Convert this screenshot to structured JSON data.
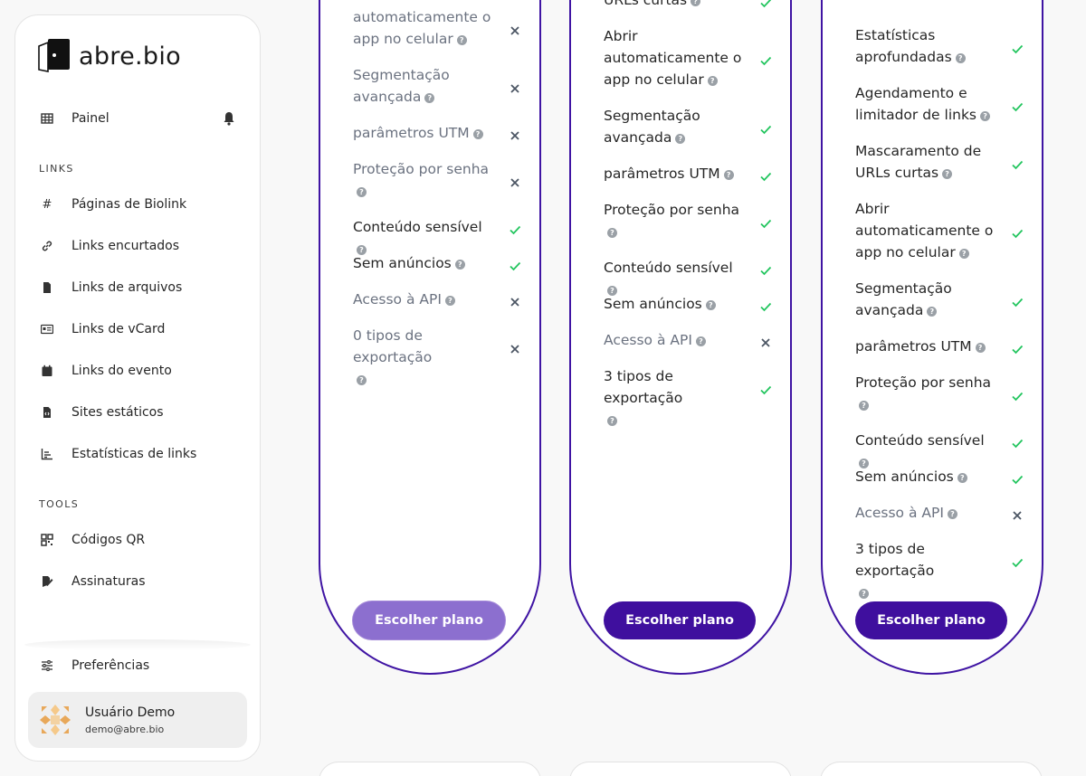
{
  "brand": {
    "name": "abre.bio"
  },
  "sidebar": {
    "dashboard": {
      "label": "Painel"
    },
    "links_section": "LINKS",
    "links_items": [
      {
        "label": "Páginas de Biolink",
        "icon": "hash-icon"
      },
      {
        "label": "Links encurtados",
        "icon": "link-icon"
      },
      {
        "label": "Links de arquivos",
        "icon": "file-icon"
      },
      {
        "label": "Links de vCard",
        "icon": "id-card-icon"
      },
      {
        "label": "Links do evento",
        "icon": "calendar-icon"
      },
      {
        "label": "Sites estáticos",
        "icon": "file-code-icon"
      },
      {
        "label": "Estatísticas de links",
        "icon": "chart-icon"
      }
    ],
    "tools_section": "TOOLS",
    "tools_items": [
      {
        "label": "Códigos QR",
        "icon": "qr-icon"
      },
      {
        "label": "Assinaturas",
        "icon": "signature-icon"
      }
    ],
    "preferences": {
      "label": "Preferências"
    },
    "user": {
      "name": "Usuário Demo",
      "email": "demo@abre.bio"
    }
  },
  "plans": [
    {
      "button": "Escolher plano",
      "features": [
        {
          "lines": [
            "automaticamente o",
            "app no celular"
          ],
          "available": false
        },
        {
          "lines": [
            "Segmentação",
            "avançada"
          ],
          "available": false
        },
        {
          "lines": [
            "parâmetros UTM"
          ],
          "available": false
        },
        {
          "lines": [
            "Proteção por senha",
            ""
          ],
          "available": false
        },
        {
          "lines": [
            "Conteúdo sensível"
          ],
          "available": true
        },
        {
          "lines": [
            "Sem anúncios"
          ],
          "available": true
        },
        {
          "lines": [
            "Acesso à API"
          ],
          "available": false
        },
        {
          "lines": [
            "0 tipos de exportação",
            ""
          ],
          "available": false
        }
      ]
    },
    {
      "button": "Escolher plano",
      "features": [
        {
          "lines": [
            "URLs curtas"
          ],
          "available": true
        },
        {
          "lines": [
            "Abrir",
            "automaticamente o",
            "app no celular"
          ],
          "available": true
        },
        {
          "lines": [
            "Segmentação",
            "avançada"
          ],
          "available": true
        },
        {
          "lines": [
            "parâmetros UTM"
          ],
          "available": true
        },
        {
          "lines": [
            "Proteção por senha",
            ""
          ],
          "available": true
        },
        {
          "lines": [
            "Conteúdo sensível"
          ],
          "available": true
        },
        {
          "lines": [
            "Sem anúncios"
          ],
          "available": true
        },
        {
          "lines": [
            "Acesso à API"
          ],
          "available": false
        },
        {
          "lines": [
            "3 tipos de exportação",
            ""
          ],
          "available": true
        }
      ]
    },
    {
      "button": "Escolher plano",
      "features": [
        {
          "lines": [
            "Estatísticas",
            "aprofundadas"
          ],
          "available": true
        },
        {
          "lines": [
            "Agendamento e",
            "limitador de links"
          ],
          "available": true
        },
        {
          "lines": [
            "Mascaramento de",
            "URLs curtas"
          ],
          "available": true
        },
        {
          "lines": [
            "Abrir",
            "automaticamente o",
            "app no celular"
          ],
          "available": true
        },
        {
          "lines": [
            "Segmentação",
            "avançada"
          ],
          "available": true
        },
        {
          "lines": [
            "parâmetros UTM"
          ],
          "available": true
        },
        {
          "lines": [
            "Proteção por senha",
            ""
          ],
          "available": true
        },
        {
          "lines": [
            "Conteúdo sensível"
          ],
          "available": true
        },
        {
          "lines": [
            "Sem anúncios"
          ],
          "available": true
        },
        {
          "lines": [
            "Acesso à API"
          ],
          "available": false
        },
        {
          "lines": [
            "3 tipos de exportação",
            ""
          ],
          "available": true
        }
      ]
    }
  ],
  "colors": {
    "accent": "#3f0f9e",
    "accent_light": "#8c6fcf",
    "check": "#22c55e",
    "cross": "#4b5563"
  }
}
